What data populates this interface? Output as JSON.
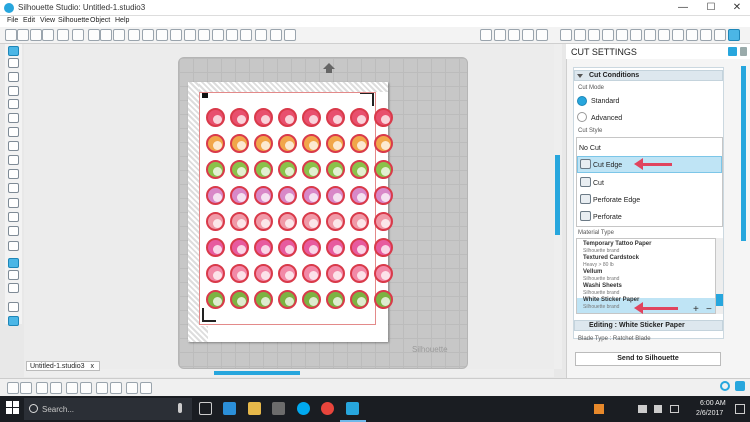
{
  "window": {
    "title": "Silhouette Studio: Untitled-1.studio3"
  },
  "menu": [
    "File",
    "Edit",
    "View",
    "Silhouette",
    "Object",
    "Help"
  ],
  "window_controls": {
    "minimize": "—",
    "maximize": "☐",
    "close": "✕"
  },
  "document_tab": {
    "label": "Untitled-1.studio3",
    "close": "x"
  },
  "canvas": {
    "watermark": "Silhouette"
  },
  "colors": {
    "accent": "#27a6dd",
    "annotation_arrow": "#e0445e",
    "sheet_outline": "#e38a8a"
  },
  "sticker_rows": [
    [
      "#e8506e",
      "#e8506e",
      "#e8506e",
      "#e8506e",
      "#e8506e",
      "#e8506e",
      "#e8506e",
      "#e8506e"
    ],
    [
      "#f1a64a",
      "#f1a64a",
      "#f1a64a",
      "#f1a64a",
      "#f1a64a",
      "#f1a64a",
      "#f1a64a",
      "#f1a64a"
    ],
    [
      "#8ac24a",
      "#8ac24a",
      "#8ac24a",
      "#8ac24a",
      "#8ac24a",
      "#8ac24a",
      "#8ac24a",
      "#8ac24a"
    ],
    [
      "#d888c8",
      "#d888c8",
      "#d888c8",
      "#d888c8",
      "#d888c8",
      "#d888c8",
      "#d888c8",
      "#d888c8"
    ],
    [
      "#f09aa8",
      "#f09aa8",
      "#f09aa8",
      "#f09aa8",
      "#f09aa8",
      "#f09aa8",
      "#f09aa8",
      "#f09aa8"
    ],
    [
      "#e75b9f",
      "#e75b9f",
      "#e75b9f",
      "#e75b9f",
      "#e75b9f",
      "#e75b9f",
      "#e75b9f",
      "#e75b9f"
    ],
    [
      "#f28aa8",
      "#f28aa8",
      "#f28aa8",
      "#f28aa8",
      "#f28aa8",
      "#f28aa8",
      "#f28aa8",
      "#f28aa8"
    ],
    [
      "#7cb342",
      "#7cb342",
      "#7cb342",
      "#7cb342",
      "#7cb342",
      "#7cb342",
      "#7cb342",
      "#7cb342"
    ]
  ],
  "panel": {
    "title": "CUT SETTINGS",
    "cut_conditions": "Cut Conditions",
    "cut_mode_label": "Cut Mode",
    "mode_standard": "Standard",
    "mode_advanced": "Advanced",
    "cut_style_label": "Cut Style",
    "no_cut": "No Cut",
    "cut_edge": "Cut Edge",
    "cut": "Cut",
    "perforate_edge": "Perforate Edge",
    "perforate": "Perforate",
    "material_type_label": "Material Type",
    "materials": [
      {
        "name": "Temporary Tattoo Paper",
        "sub": "Silhouette brand"
      },
      {
        "name": "Textured Cardstock",
        "sub": "Heavy > 80 lb"
      },
      {
        "name": "Vellum",
        "sub": "Silhouette brand"
      },
      {
        "name": "Washi Sheets",
        "sub": "Silhouette brand"
      },
      {
        "name": "White Sticker Paper",
        "sub": "Silhouette brand"
      }
    ],
    "add": "+",
    "remove": "−",
    "editing": "Editing : White Sticker Paper",
    "blade_type": "Blade Type : Ratchet Blade",
    "send": "Send to Silhouette"
  },
  "taskbar": {
    "search_placeholder": "Search...",
    "time": "6:00 AM",
    "date": "2/6/2017"
  }
}
